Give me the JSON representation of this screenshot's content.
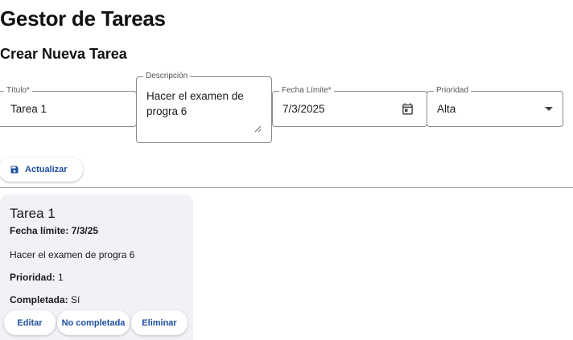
{
  "app": {
    "title": "Gestor de Tareas"
  },
  "form": {
    "heading": "Crear Nueva Tarea",
    "title_field": {
      "label": "Título*",
      "value": "Tarea 1"
    },
    "description_field": {
      "label": "Descripción",
      "value": "Hacer el examen de progra 6"
    },
    "due_date_field": {
      "label": "Fecha Límite*",
      "value": "7/3/2025"
    },
    "priority_field": {
      "label": "Prioridad",
      "value": "Alta"
    },
    "submit_label": "Actualizar"
  },
  "tasks": [
    {
      "title": "Tarea 1",
      "due_label": "Fecha límite:",
      "due_value": "7/3/25",
      "description": "Hacer el examen de progra 6",
      "priority_label": "Prioridad:",
      "priority_value": "1",
      "completed_label": "Completada:",
      "completed_value": "Sí",
      "edit_label": "Editar",
      "toggle_label": "No completada",
      "delete_label": "Eliminar"
    }
  ],
  "colors": {
    "accent": "#1c4fa0",
    "card_background": "#f2f1f6",
    "border": "#8a8a8a"
  },
  "icons": {
    "submit": "save-icon",
    "date": "calendar-icon",
    "priority": "chevron-down-icon"
  }
}
